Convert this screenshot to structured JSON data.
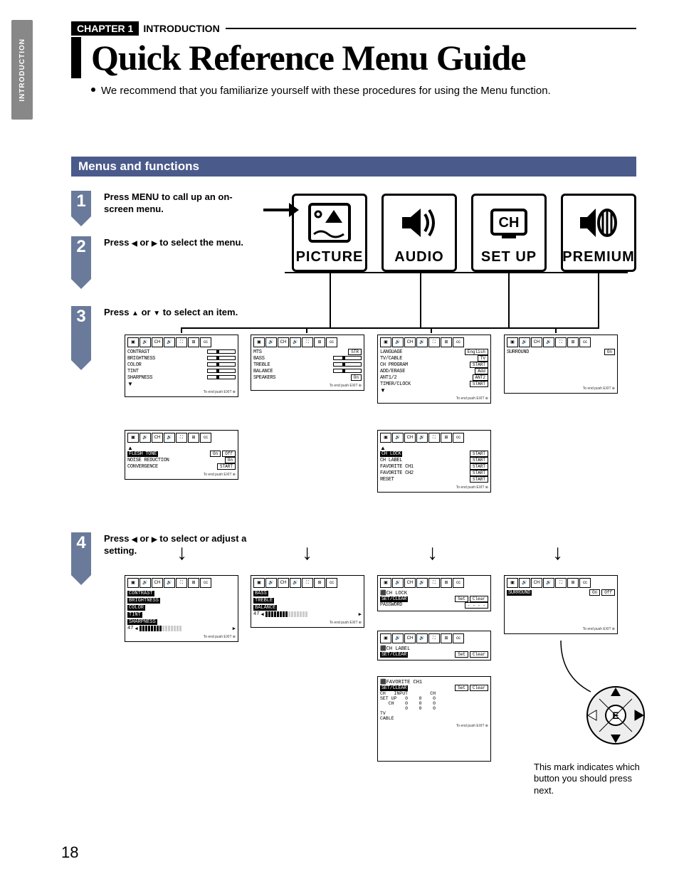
{
  "side_tab": "INTRODUCTION",
  "chapter": {
    "badge": "CHAPTER 1",
    "label": "INTRODUCTION"
  },
  "title": "Quick Reference Menu Guide",
  "intro": "We recommend that you familiarize yourself with these procedures for using the Menu function.",
  "section": "Menus and functions",
  "steps": {
    "s1": {
      "num": "1",
      "pre": "Press ",
      "bold": "MENU",
      "post": " to call up an on-screen menu."
    },
    "s2": {
      "num": "2",
      "pre": "Press ",
      "mid": " or ",
      "post": " to select the menu."
    },
    "s3": {
      "num": "3",
      "pre": "Press ",
      "mid": " or ",
      "post": " to select an item."
    },
    "s4": {
      "num": "4",
      "pre": "Press ",
      "mid": " or ",
      "post": " to select or adjust a setting."
    }
  },
  "menus": {
    "picture": "PICTURE",
    "audio": "AUDIO",
    "setup": "SET UP",
    "premium": "PREMIUM"
  },
  "osd": {
    "picture1": {
      "items": [
        {
          "k": "CONTRAST",
          "t": "slider"
        },
        {
          "k": "BRIGHTNESS",
          "t": "slider"
        },
        {
          "k": "COLOR",
          "t": "slider"
        },
        {
          "k": "TINT",
          "t": "slider"
        },
        {
          "k": "SHARPNESS",
          "t": "slider"
        }
      ]
    },
    "picture2": {
      "items": [
        {
          "k": "FLESH TONE",
          "v": "On",
          "v2": "Off",
          "inv": true
        },
        {
          "k": "NOISE REDUCTION",
          "v": "On"
        },
        {
          "k": "CONVERGENCE",
          "v": "START"
        }
      ]
    },
    "audio1": {
      "items": [
        {
          "k": "MTS",
          "v": "STR"
        },
        {
          "k": "BASS",
          "t": "slider"
        },
        {
          "k": "TREBLE",
          "t": "slider"
        },
        {
          "k": "BALANCE",
          "t": "slider"
        },
        {
          "k": "SPEAKERS",
          "v": "On"
        }
      ]
    },
    "setup1": {
      "items": [
        {
          "k": "LANGUAGE",
          "v": "English"
        },
        {
          "k": "TV/CABLE",
          "v": "TV"
        },
        {
          "k": "CH PROGRAM",
          "v": "START"
        },
        {
          "k": "ADD/ERASE",
          "v": "Add"
        },
        {
          "k": "ANT1/2",
          "v": "ANT2"
        },
        {
          "k": "TIMER/CLOCK",
          "v": "START"
        }
      ]
    },
    "setup2": {
      "items": [
        {
          "k": "CH LOCK",
          "v": "START",
          "inv": true
        },
        {
          "k": "CH LABEL",
          "v": "START"
        },
        {
          "k": "FAVORITE CH1",
          "v": "START"
        },
        {
          "k": "FAVORITE CH2",
          "v": "START"
        },
        {
          "k": "RESET",
          "v": "START"
        }
      ]
    },
    "premium1": {
      "items": [
        {
          "k": "SURROUND",
          "v": "On"
        }
      ]
    },
    "picture_adj": {
      "labels": [
        "CONTRAST",
        "BRIGHTNESS",
        "COLOR",
        "TINT",
        "SHARPNESS"
      ],
      "bar": "47"
    },
    "audio_adj": {
      "labels": [
        "BASS",
        "TREBLE",
        "BALANCE"
      ],
      "bar": "47"
    },
    "setup_adj_lock": {
      "title": "CH LOCK",
      "row": {
        "k": "SET/CLEAR",
        "v": "Set",
        "v2": "Clear"
      },
      "pw": "PASSWORD",
      "dots": "- - - -"
    },
    "setup_adj_label": {
      "title": "CH LABEL",
      "row": {
        "k": "SET/CLEAR",
        "v": "Set",
        "v2": "Clear"
      }
    },
    "setup_adj_fav": {
      "title": "FAVORITE CH1",
      "row": {
        "k": "SET/CLEAR",
        "v": "Set",
        "v2": "Clear"
      },
      "lines": [
        "CH   INPUT        CH",
        "SET UP   0    0    0",
        "   CH    0    0    0",
        "         0    0    0",
        "TV",
        "CABLE"
      ]
    },
    "premium_adj": {
      "items": [
        {
          "k": "SURROUND",
          "v": "On",
          "v2": "Off",
          "inv": true
        }
      ]
    }
  },
  "foot_hint": "To end push EXIT",
  "nav_note": "This mark indicates which button you should press next.",
  "page_number": "18"
}
